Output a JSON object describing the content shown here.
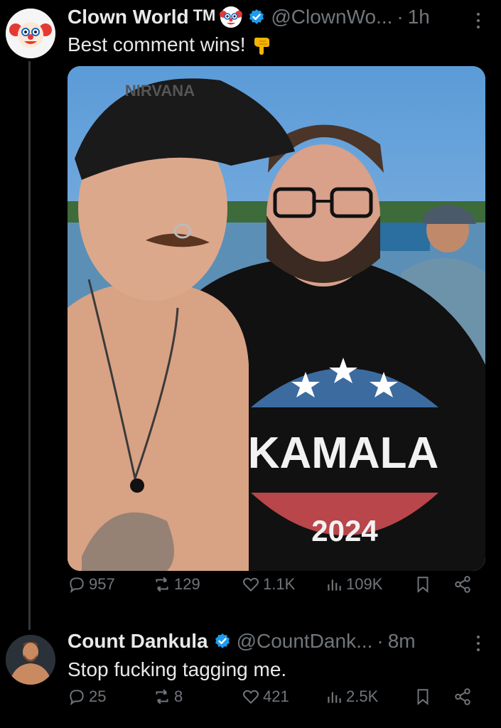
{
  "posts": [
    {
      "author_name": "Clown World",
      "author_suffix": "TM",
      "handle": "@ClownWo...",
      "separator": "·",
      "time": "1h",
      "text": "Best comment wins!",
      "emoji_after_name": "clown-face-emoji",
      "emoji_after_text": "backhand-index-pointing-down-emoji",
      "verified": true,
      "media": {
        "shirt_text": "KAMALA",
        "shirt_year": "2024",
        "hat_text": "NIRVANA"
      },
      "stats": {
        "replies": "957",
        "reposts": "129",
        "likes": "1.1K",
        "views": "109K"
      }
    },
    {
      "author_name": "Count Dankula",
      "handle": "@CountDank...",
      "separator": "·",
      "time": "8m",
      "text": "Stop fucking tagging me.",
      "verified": true,
      "stats": {
        "replies": "25",
        "reposts": "8",
        "likes": "421",
        "views": "2.5K"
      }
    }
  ],
  "colors": {
    "background": "#000000",
    "text": "#e7e9ea",
    "secondary": "#71767b",
    "verified": "#1d9bf0",
    "thread_line": "#333639"
  }
}
